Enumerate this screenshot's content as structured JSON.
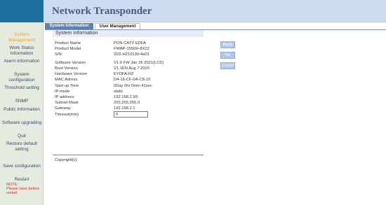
{
  "header": {
    "title": "Network Transponder"
  },
  "sidebar": {
    "items": [
      {
        "label": "System Management",
        "active": true
      },
      {
        "label": "Work Status Information"
      },
      {
        "label": "Alarm information"
      },
      {
        "label": "System configuration"
      },
      {
        "label": "Threshold setting"
      },
      {
        "label": "SNMP"
      },
      {
        "label": "Public Information"
      },
      {
        "label": "Software upgrading"
      },
      {
        "label": "Quit"
      },
      {
        "label": "Restore default setting"
      },
      {
        "label": "Save configuration"
      },
      {
        "label": "Restart"
      }
    ],
    "note_title": "NOTE:",
    "note_text": "Please save before restart"
  },
  "tabs": [
    {
      "label": "System Information",
      "active": true
    },
    {
      "label": "User Management",
      "active": false
    }
  ],
  "section": {
    "title": "System Information"
  },
  "info": [
    {
      "label": "Product Name",
      "value": "PON CATV EDFA"
    },
    {
      "label": "Product Model",
      "value": "FWAP-1550H-8X22"
    },
    {
      "label": "S/N:",
      "value": "2D2-H210130-4a01"
    },
    {
      "label": "Software Version",
      "value": "V1.0 FW Jan 26 2021(LCD)"
    },
    {
      "label": "Boot Version",
      "value": "V1.1EN Aug 7 2020"
    },
    {
      "label": "Hardware Version",
      "value": "EYDFA-N2"
    },
    {
      "label": "MAC Adress",
      "value": "D4-16-CF-0A-C8-10"
    },
    {
      "label": "Start up Time",
      "value": "0Day 0hr 0min 41sec"
    },
    {
      "label": "IP mode",
      "value": "static"
    },
    {
      "label": "IP address",
      "value": "192.168.2.99"
    },
    {
      "label": "Subnet Mask",
      "value": "255.255.255.0"
    },
    {
      "label": "Gateway",
      "value": "192.168.2.1"
    }
  ],
  "timeout": {
    "label": "Timeout(min)",
    "value": "0"
  },
  "buttons": {
    "apply": "Apply",
    "ok": "Ok",
    "cancel": "Cancel"
  },
  "footer": {
    "copyright": "Copyright(c)"
  },
  "colors": {
    "header_bg": "#cddcf0",
    "sidebar_bg": "#e6ebe0",
    "active_nav": "#f2a31a",
    "tab_active": "#5f7fae",
    "note": "#d62b2b"
  }
}
